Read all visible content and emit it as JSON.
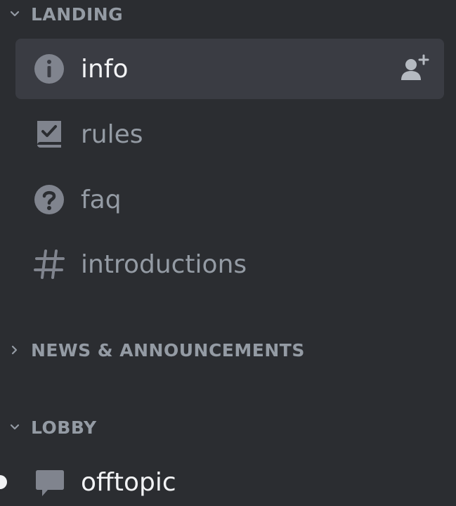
{
  "categories": [
    {
      "label": "LANDING",
      "expanded": true
    },
    {
      "label": "NEWS & ANNOUNCEMENTS",
      "expanded": false
    },
    {
      "label": "LOBBY",
      "expanded": true
    }
  ],
  "channels": [
    {
      "name": "info",
      "icon": "info-icon",
      "selected": true
    },
    {
      "name": "rules",
      "icon": "rules-icon"
    },
    {
      "name": "faq",
      "icon": "question-icon"
    },
    {
      "name": "introductions",
      "icon": "hashtag-icon"
    },
    {
      "name": "offtopic",
      "icon": "forum-icon",
      "unread": true
    }
  ],
  "colors": {
    "background": "#2b2d31",
    "selected_background": "#3a3c43",
    "muted_text": "#949ba4",
    "active_text": "#f2f3f5"
  }
}
